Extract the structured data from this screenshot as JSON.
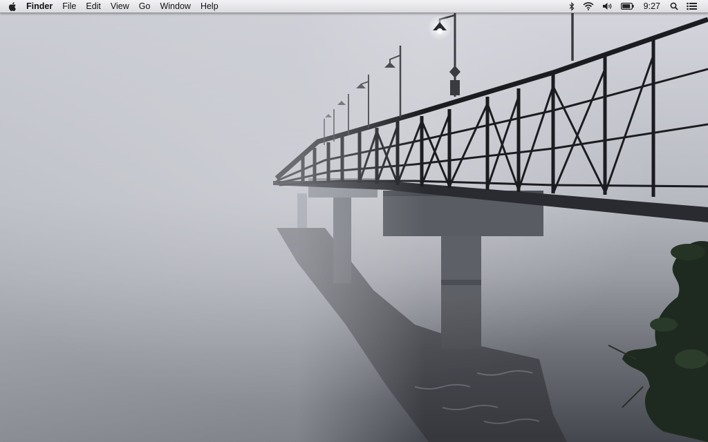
{
  "menubar": {
    "apple_icon": "apple-logo-icon",
    "app_name": "Finder",
    "items": [
      "File",
      "Edit",
      "View",
      "Go",
      "Window",
      "Help"
    ],
    "status": {
      "bluetooth_icon": "bluetooth-icon",
      "wifi_icon": "wifi-icon",
      "volume_icon": "volume-icon",
      "battery_icon": "battery-icon",
      "time": "9:27",
      "spotlight_icon": "spotlight-search-icon",
      "notification_icon": "notification-center-icon"
    }
  },
  "desktop": {
    "wallpaper": "foggy-bridge-over-water"
  },
  "colors": {
    "menubar_top": "#f2f2f4",
    "menubar_bottom": "#dcdce0",
    "fog": "#c9cbd3",
    "water": "#55575f",
    "bridge": "#1b1c20"
  }
}
